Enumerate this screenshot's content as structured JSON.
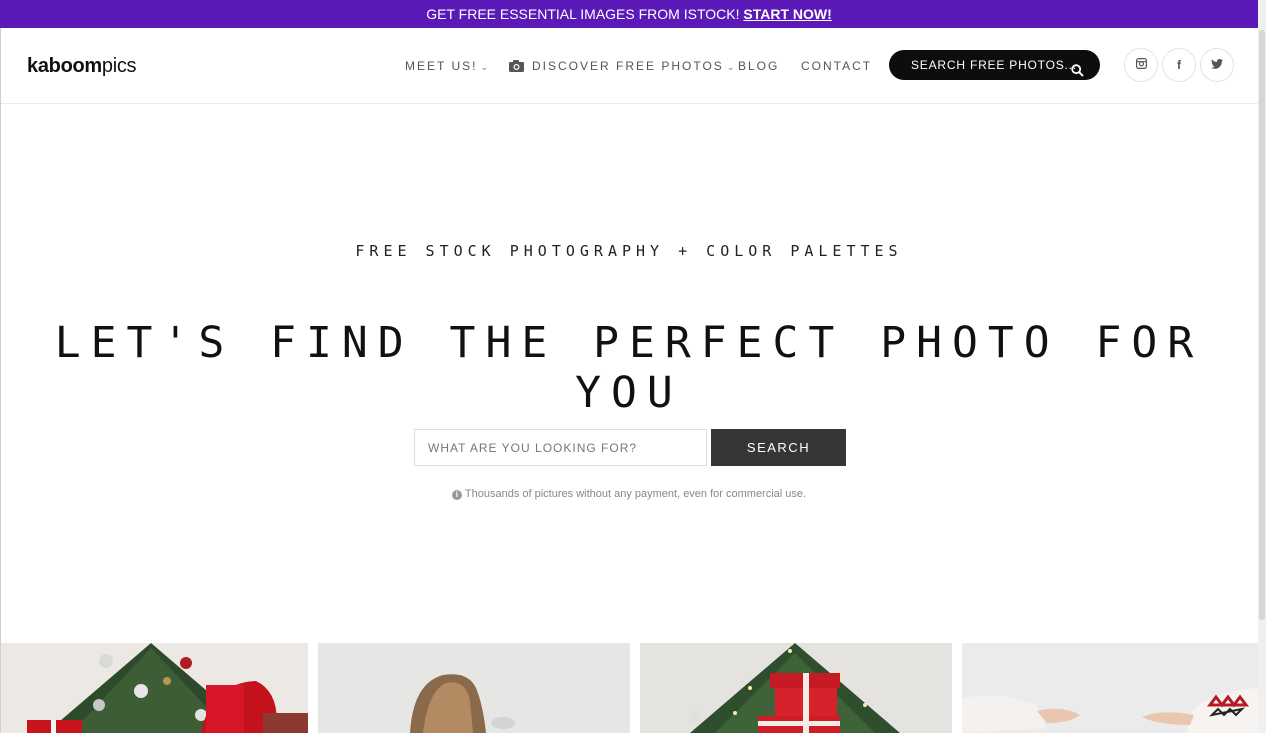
{
  "promo": {
    "text": "GET FREE ESSENTIAL IMAGES FROM ISTOCK!",
    "link": "START NOW!"
  },
  "header": {
    "logo_bold": "kaboom",
    "logo_light": "pics",
    "nav": {
      "meet": "MEET US!",
      "discover": "DISCOVER FREE PHOTOS",
      "blog": "BLOG",
      "contact": "CONTACT"
    },
    "search_pill": "SEARCH FREE PHOTOS...",
    "social": {
      "instagram_icon": "instagram-icon",
      "facebook_glyph": "f",
      "twitter_icon": "twitter-icon"
    }
  },
  "hero": {
    "subtitle": "FREE STOCK PHOTOGRAPHY + COLOR PALETTES",
    "title": "LET'S FIND THE PERFECT PHOTO FOR YOU",
    "search_placeholder": "WHAT ARE YOU LOOKING FOR?",
    "search_button": "SEARCH",
    "hint": "Thousands of pictures without any payment, even for commercial use."
  },
  "gallery": {
    "items": [
      "christmas-tree-gifts-photo",
      "woman-hair-photo",
      "christmas-tree-gift-boxes-photo",
      "hands-sweaters-photo"
    ]
  },
  "colors": {
    "promo_bg": "#5b1ab8",
    "search_pill_bg": "#0d0d0d",
    "search_button_bg": "#363636"
  }
}
